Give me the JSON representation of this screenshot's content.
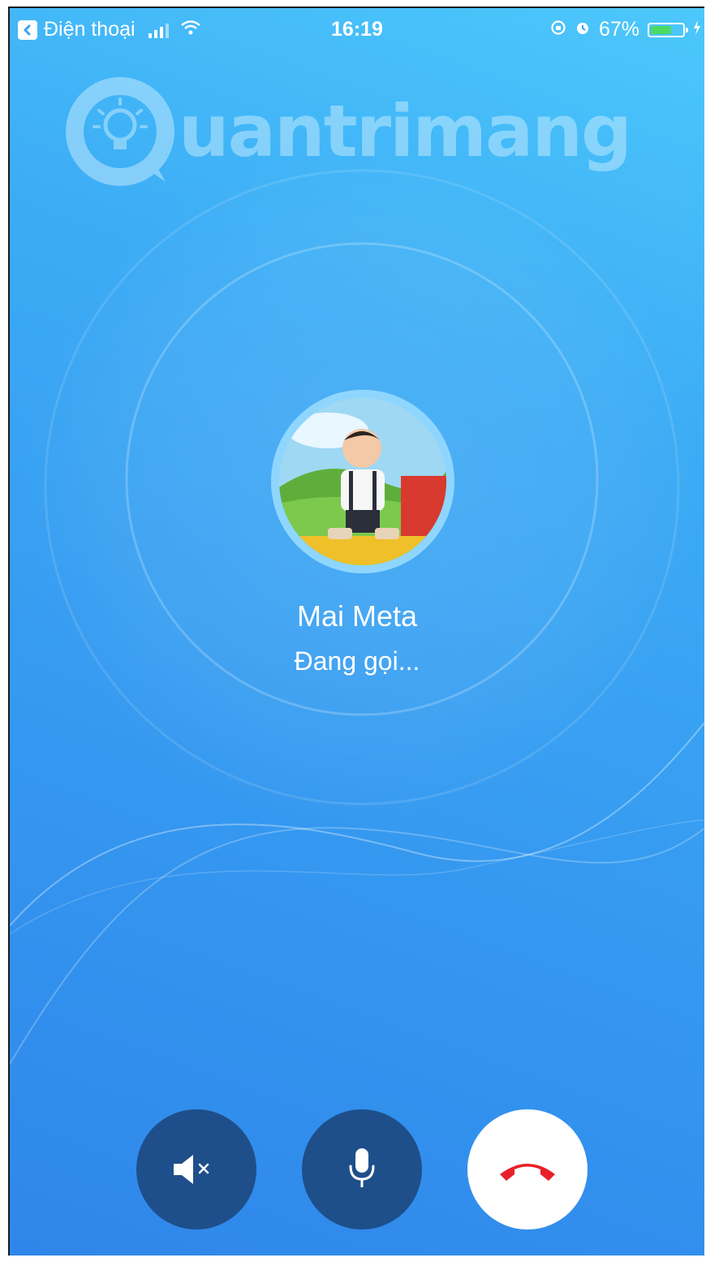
{
  "status_bar": {
    "back_app": "Điện thoại",
    "time": "16:19",
    "battery_percent": "67%",
    "battery_level": 0.67
  },
  "watermark": {
    "text": "uantrimang"
  },
  "call": {
    "caller_name": "Mai Meta",
    "status": "Đang gọi..."
  },
  "controls": {
    "speaker_icon": "speaker-mute-icon",
    "mic_icon": "microphone-icon",
    "end_icon": "phone-hangup-icon"
  },
  "colors": {
    "background_top": "#4cc8fb",
    "background_bottom": "#2f86ea",
    "control_dark": "#1e4f8a",
    "end_call_red": "#e8202a",
    "battery_green": "#4cd964"
  }
}
